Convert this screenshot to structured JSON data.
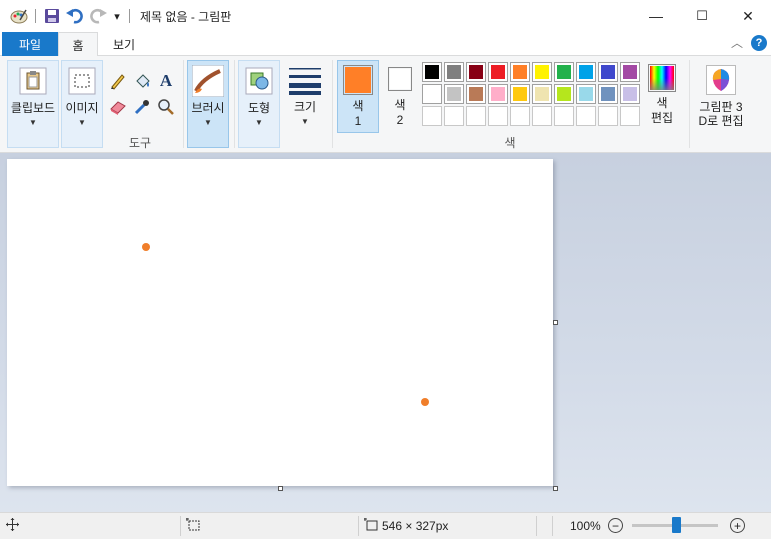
{
  "window": {
    "title": "제목 없음 - 그림판",
    "minimize_glyph": "—",
    "maximize_glyph": "☐",
    "close_glyph": "✕"
  },
  "quick_access": {
    "icons": [
      "paint-app-icon",
      "save-icon",
      "undo-icon",
      "redo-icon",
      "customize-dropdown-icon"
    ],
    "dropdown_glyph": "▾"
  },
  "tabs": {
    "file": "파일",
    "home": "홈",
    "view": "보기",
    "collapse_glyph": "︿",
    "help_glyph": "?"
  },
  "ribbon": {
    "clipboard": {
      "label": "클립보드",
      "caret": "▼"
    },
    "image": {
      "label": "이미지",
      "caret": "▼"
    },
    "tools": {
      "group_label": "도구",
      "text_tool": "A"
    },
    "brushes": {
      "label": "브러시",
      "caret": "▼"
    },
    "shapes": {
      "label": "도형",
      "caret": "▼"
    },
    "size": {
      "label": "크기",
      "caret": "▼"
    },
    "color1": {
      "label": "색",
      "label2": "1",
      "value": "#ff7f27"
    },
    "color2": {
      "label": "색",
      "label2": "2",
      "value": "#ffffff"
    },
    "colors_group_label": "색",
    "edit_colors": {
      "label": "색",
      "label2": "편집"
    },
    "paint3d": {
      "label": "그림판 3",
      "label2": "D로 편집"
    },
    "palette_row1": [
      "#000000",
      "#7f7f7f",
      "#880015",
      "#ed1c24",
      "#ff7f27",
      "#fff200",
      "#22b14c",
      "#00a2e8",
      "#3f48cc",
      "#a349a4"
    ],
    "palette_row2": [
      "#ffffff",
      "#c3c3c3",
      "#b97a57",
      "#ffaec9",
      "#ffc90e",
      "#efe4b0",
      "#b5e61d",
      "#99d9ea",
      "#7092be",
      "#c8bfe7"
    ]
  },
  "canvas": {
    "background": "#ffffff",
    "dot_color": "#f07e2a"
  },
  "status": {
    "dimensions": "546 × 327px",
    "zoom": "100%",
    "zoom_out": "−",
    "zoom_in": "+"
  }
}
